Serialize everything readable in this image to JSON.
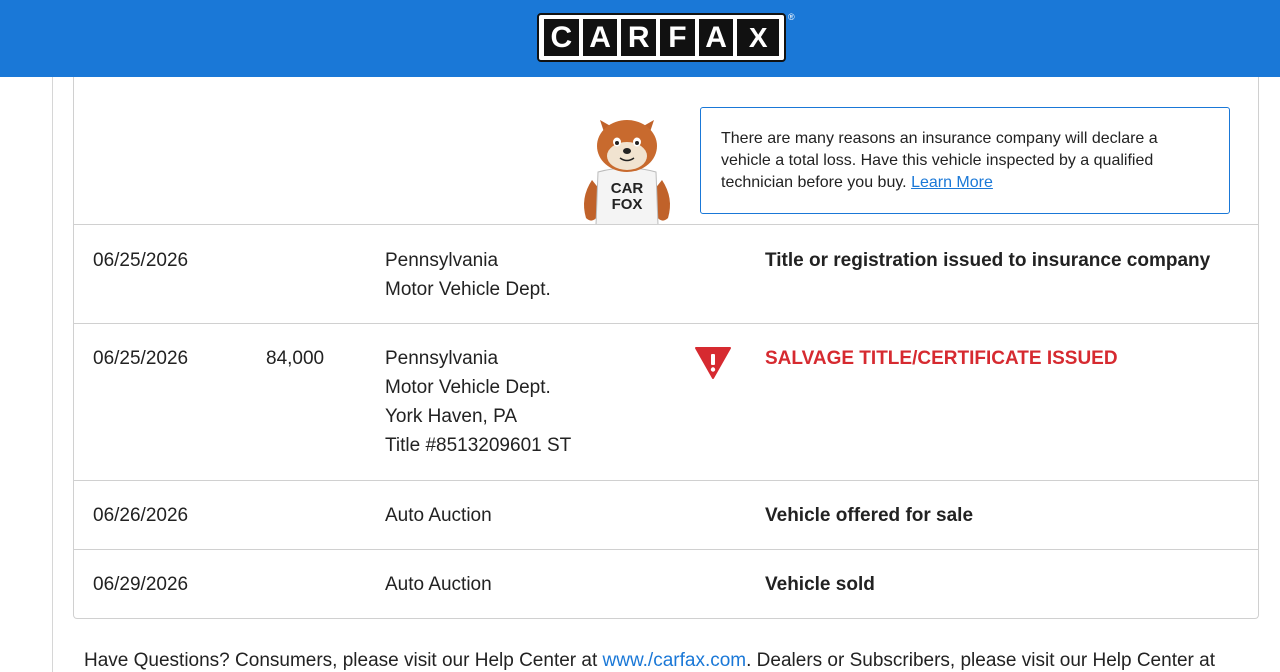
{
  "header": {
    "logo_letters": [
      "C",
      "A",
      "R",
      "F",
      "A",
      "X"
    ],
    "registered_mark": "®",
    "background_color": "#1a78d7"
  },
  "mascot": {
    "shirt_line1": "CAR",
    "shirt_line2": "FOX"
  },
  "callout": {
    "text": "There are many reasons an insurance company will declare a vehicle a total loss. Have this vehicle inspected by a qualified technician before you buy.",
    "link_label": "Learn More",
    "border_color": "#1a78d7"
  },
  "history_rows": [
    {
      "date": "06/25/2026",
      "mileage": "",
      "source_lines": [
        "Pennsylvania",
        "Motor Vehicle Dept."
      ],
      "comment": "Title or registration issued to insurance company",
      "alert": false
    },
    {
      "date": "06/25/2026",
      "mileage": "84,000",
      "source_lines": [
        "Pennsylvania",
        "Motor Vehicle Dept.",
        "York Haven, PA",
        "Title #8513209601 ST"
      ],
      "comment": "SALVAGE TITLE/CERTIFICATE ISSUED",
      "alert": true,
      "alert_icon": "warning-triangle-icon",
      "alert_color": "#d62a30"
    },
    {
      "date": "06/26/2026",
      "mileage": "",
      "source_lines": [
        "Auto Auction"
      ],
      "comment": "Vehicle offered for sale",
      "alert": false
    },
    {
      "date": "06/29/2026",
      "mileage": "",
      "source_lines": [
        "Auto Auction"
      ],
      "comment": "Vehicle sold",
      "alert": false
    }
  ],
  "footer": {
    "text_before": "Have Questions? Consumers, please visit our Help Center at ",
    "link_label": "www./carfax.com",
    "text_after": ". Dealers or Subscribers, please visit our Help Center at"
  }
}
